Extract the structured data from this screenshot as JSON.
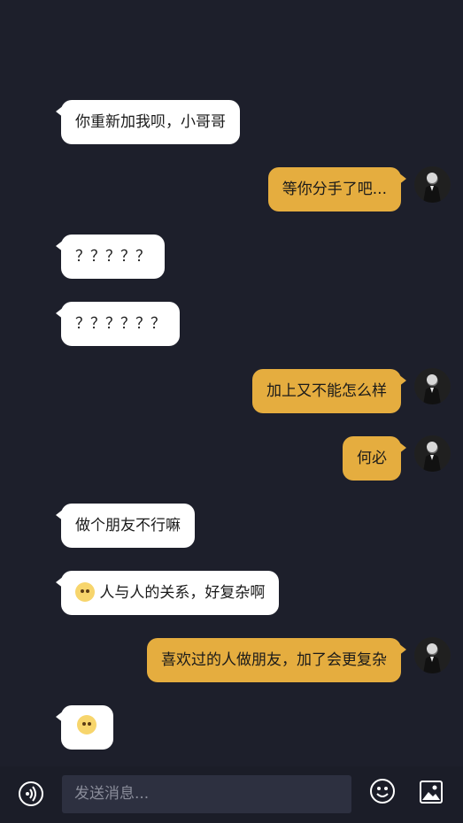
{
  "messages": [
    {
      "side": "in",
      "text": "你重新加我呗，小哥哥"
    },
    {
      "side": "out",
      "text": "等你分手了吧..."
    },
    {
      "side": "in",
      "text": "？？？？？"
    },
    {
      "side": "in",
      "text": "？？？？？？"
    },
    {
      "side": "out",
      "text": "加上又不能怎么样"
    },
    {
      "side": "out",
      "text": "何必"
    },
    {
      "side": "in",
      "text": "做个朋友不行嘛"
    },
    {
      "side": "in",
      "text": "人与人的关系，好复杂啊",
      "icon": "thinking-emoji"
    },
    {
      "side": "out",
      "text": "喜欢过的人做朋友，加了会更复杂"
    },
    {
      "side": "in",
      "text": "",
      "icon": "shocked-emoji"
    }
  ],
  "input": {
    "placeholder": "发送消息..."
  },
  "icons": {
    "voice": "voice-icon",
    "emoji": "smiley-icon",
    "image": "image-icon"
  },
  "colors": {
    "background": "#1d1f2b",
    "incoming": "#ffffff",
    "outgoing": "#e5ad3f"
  }
}
